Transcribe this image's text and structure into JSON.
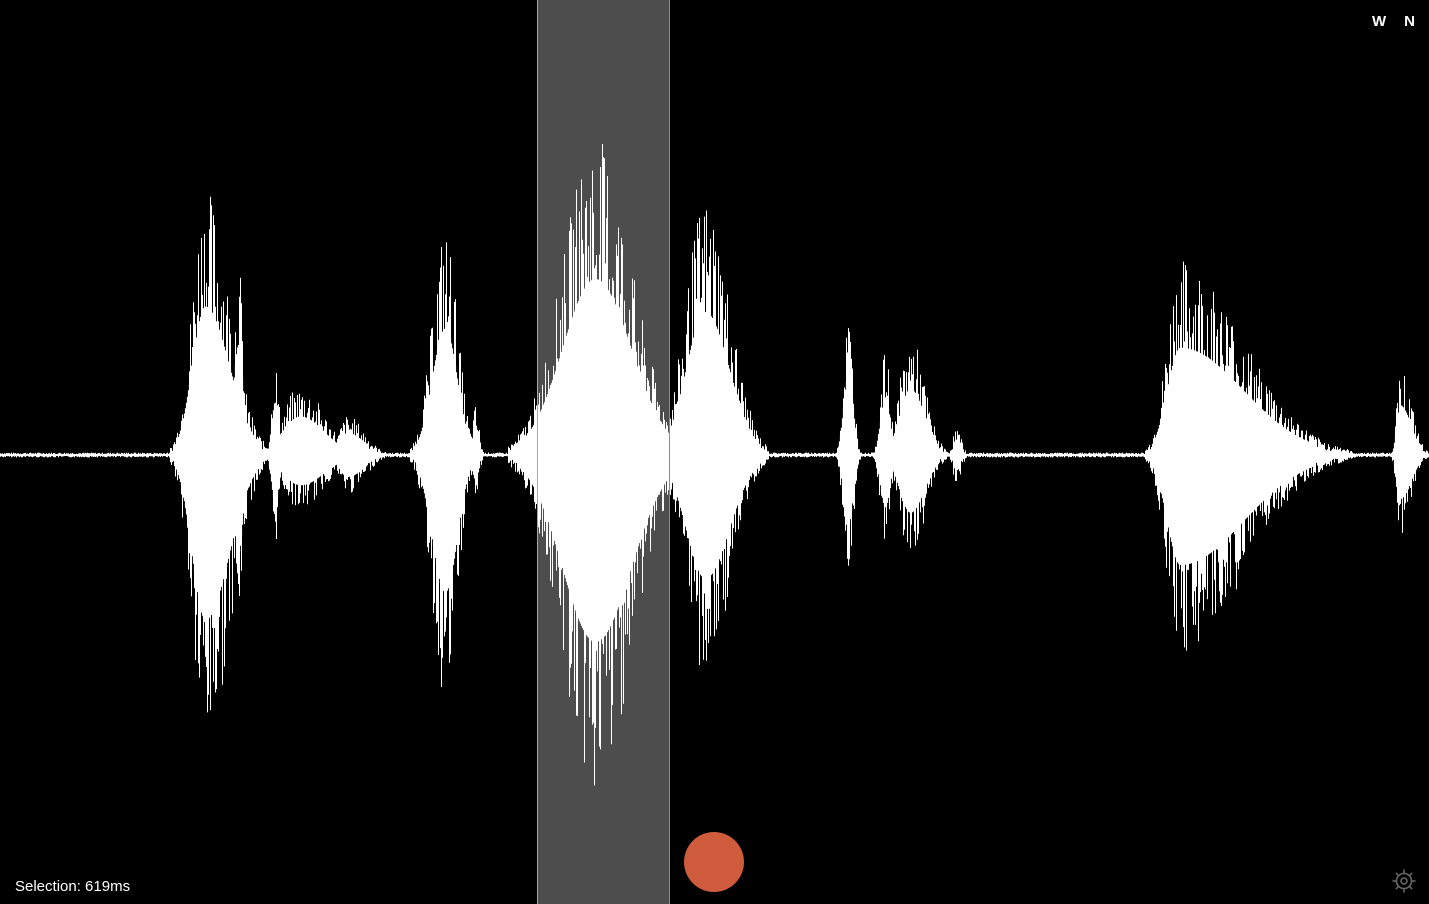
{
  "toolbar": {
    "mode_w_label": "W",
    "mode_n_label": "N"
  },
  "status": {
    "selection_label": "Selection: 619ms"
  },
  "icons": {
    "settings": "gear-icon"
  },
  "colors": {
    "background": "#000000",
    "waveform": "#ffffff",
    "selection_fill": "#4d4d4d",
    "selection_start_marker": "#8fc06a",
    "selection_end_marker": "#e46a55",
    "record_button": "#cd5b3c",
    "settings_icon": "#666666"
  }
}
